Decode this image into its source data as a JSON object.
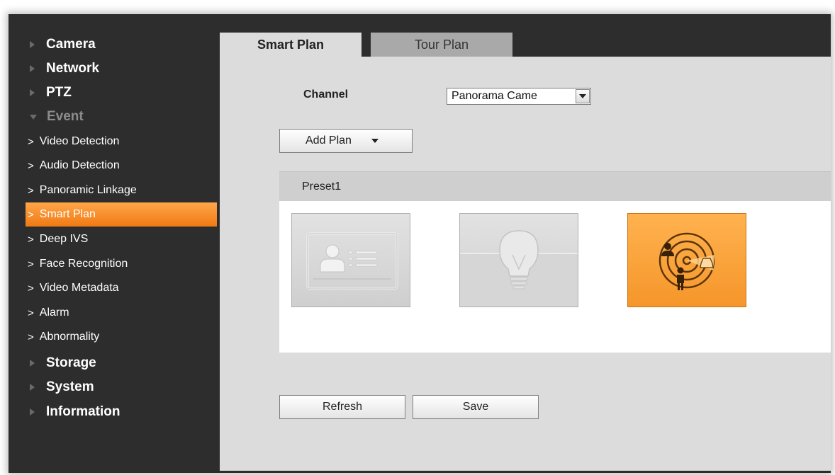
{
  "sidebar": {
    "items": [
      {
        "label": "Camera",
        "type": "top"
      },
      {
        "label": "Network",
        "type": "top"
      },
      {
        "label": "PTZ",
        "type": "top"
      },
      {
        "label": "Event",
        "type": "top-open"
      },
      {
        "label": "Video Detection",
        "type": "sub"
      },
      {
        "label": "Audio Detection",
        "type": "sub"
      },
      {
        "label": "Panoramic Linkage",
        "type": "sub"
      },
      {
        "label": "Smart Plan",
        "type": "sub",
        "active": true
      },
      {
        "label": "Deep IVS",
        "type": "sub"
      },
      {
        "label": "Face Recognition",
        "type": "sub"
      },
      {
        "label": "Video Metadata",
        "type": "sub"
      },
      {
        "label": "Alarm",
        "type": "sub"
      },
      {
        "label": "Abnormality",
        "type": "sub"
      },
      {
        "label": "Storage",
        "type": "top"
      },
      {
        "label": "System",
        "type": "top"
      },
      {
        "label": "Information",
        "type": "top"
      }
    ],
    "sub_prefix": ">"
  },
  "tabs": [
    {
      "label": "Smart Plan",
      "active": true
    },
    {
      "label": "Tour Plan",
      "active": false
    }
  ],
  "form": {
    "channel_label": "Channel",
    "channel_value": "Panorama Came"
  },
  "buttons": {
    "add_plan": "Add Plan",
    "refresh": "Refresh",
    "save": "Save"
  },
  "preset": {
    "title": "Preset1",
    "cards": [
      {
        "icon": "face-id-card-icon",
        "selected": false
      },
      {
        "icon": "lightbulb-icon",
        "selected": false
      },
      {
        "icon": "radar-people-vehicle-icon",
        "selected": true
      }
    ]
  },
  "colors": {
    "sidebar_bg": "#2d2d2d",
    "accent": "#f59228",
    "content_bg": "#dcdcdc"
  }
}
